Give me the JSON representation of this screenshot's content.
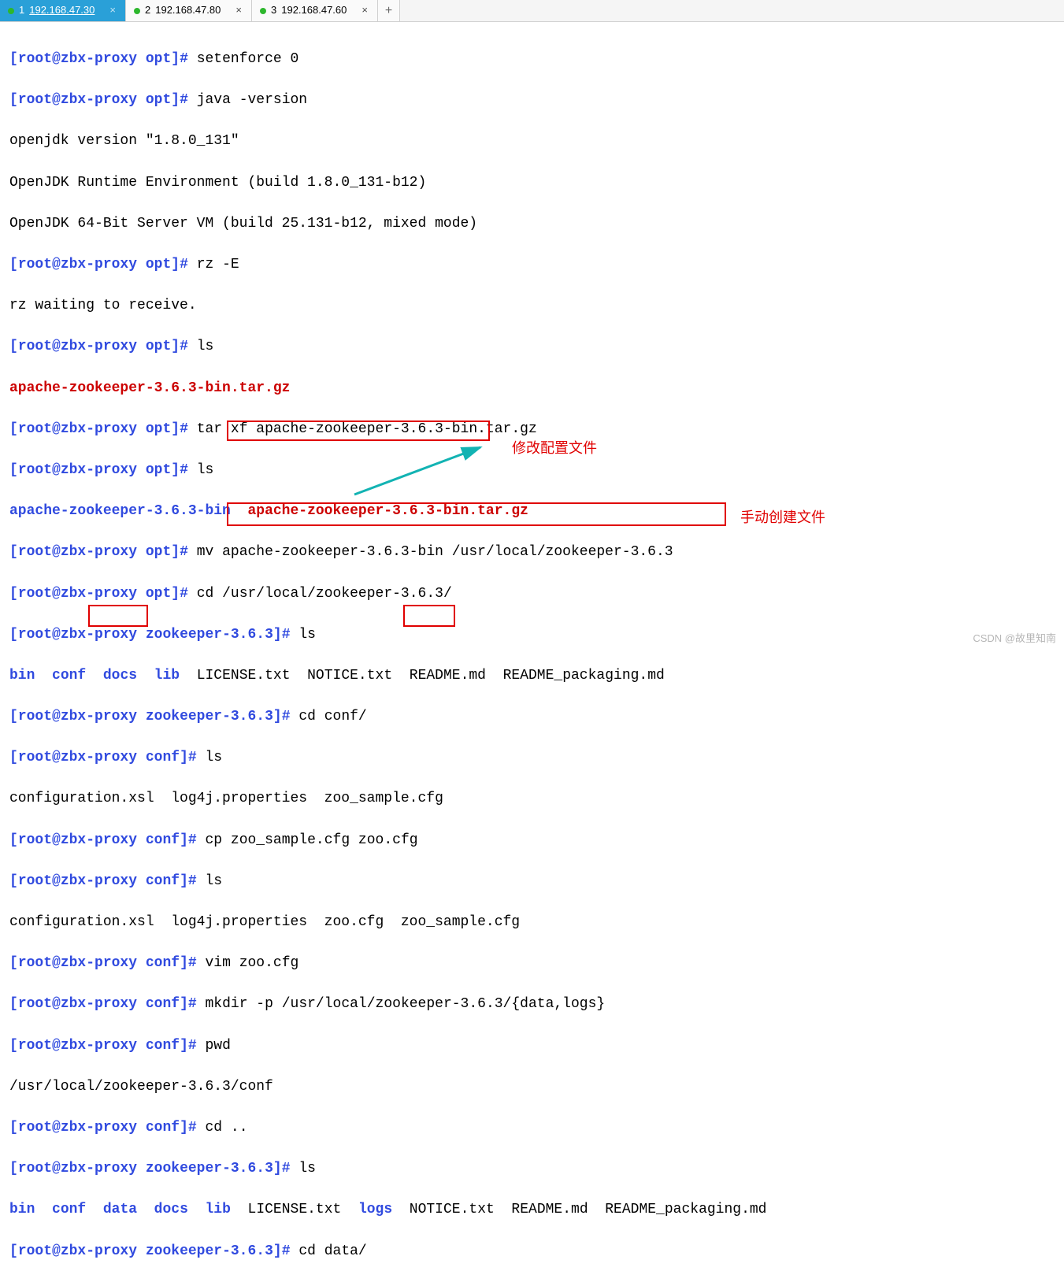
{
  "tabs": [
    {
      "index": "1",
      "title": "192.168.47.30",
      "active": true
    },
    {
      "index": "2",
      "title": "192.168.47.80",
      "active": false
    },
    {
      "index": "3",
      "title": "192.168.47.60",
      "active": false
    }
  ],
  "prompt": {
    "user_host": "root@zbx-proxy",
    "dir_opt": "opt",
    "dir_zk": "zookeeper-3.6.3",
    "dir_conf": "conf",
    "open": "[",
    "close": "]#"
  },
  "cmd": {
    "setenforce": "setenforce 0",
    "java_version": "java -version",
    "rz": "rz -E",
    "ls": "ls",
    "tar": "tar xf apache-zookeeper-3.6.3-bin.tar.gz",
    "mv": "mv apache-zookeeper-3.6.3-bin /usr/local/zookeeper-3.6.3",
    "cd_zk": "cd /usr/local/zookeeper-3.6.3/",
    "cd_conf": "cd conf/",
    "cp": "cp zoo_sample.cfg zoo.cfg",
    "vim": "vim zoo.cfg",
    "mkdir": "mkdir -p /usr/local/zookeeper-3.6.3/{data,logs}",
    "pwd": "pwd",
    "cd_up": "cd ..",
    "cd_data": "cd data/"
  },
  "out": {
    "jdk1": "openjdk version \"1.8.0_131\"",
    "jdk2": "OpenJDK Runtime Environment (build 1.8.0_131-b12)",
    "jdk3": "OpenJDK 64-Bit Server VM (build 25.131-b12, mixed mode)",
    "rz_wait": "rz waiting to receive.",
    "ls_opt_1": "apache-zookeeper-3.6.3-bin.tar.gz",
    "ls_opt_2a": "apache-zookeeper-3.6.3-bin",
    "ls_opt_2b": "apache-zookeeper-3.6.3-bin.tar.gz",
    "ls_zk_bin": "bin",
    "ls_zk_conf": "conf",
    "ls_zk_docs": "docs",
    "ls_zk_lib": "lib",
    "ls_zk_license": "LICENSE.txt",
    "ls_zk_notice": "NOTICE.txt",
    "ls_zk_readme": "README.md",
    "ls_zk_pkg": "README_packaging.md",
    "ls_conf_1": "configuration.xsl  log4j.properties  zoo_sample.cfg",
    "ls_conf_2": "configuration.xsl  log4j.properties  zoo.cfg  zoo_sample.cfg",
    "pwd_out": "/usr/local/zookeeper-3.6.3/conf",
    "ls_zk2_data": "data",
    "ls_zk2_logs": "logs"
  },
  "callouts": {
    "modify": "修改配置文件",
    "manual": "手动创建文件"
  },
  "watermark": "CSDN @故里知南"
}
